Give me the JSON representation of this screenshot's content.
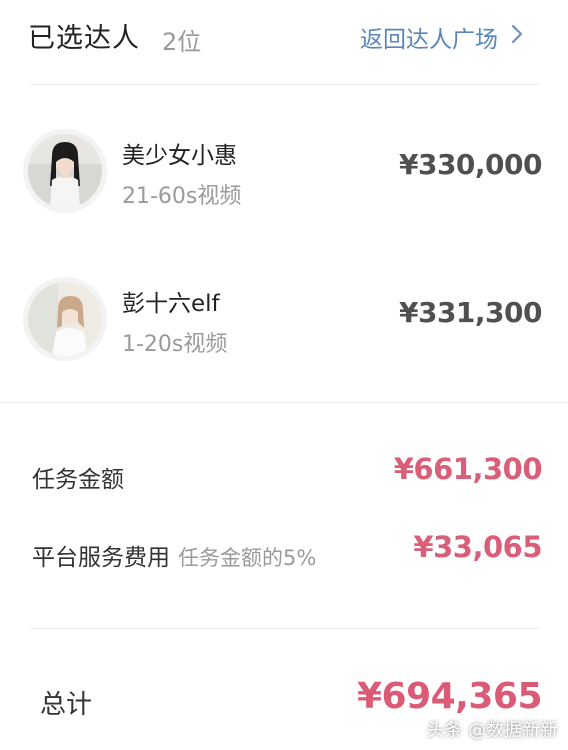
{
  "header": {
    "title": "已选达人",
    "count": "2位",
    "back_link": "返回达人广场",
    "back_icon": "chevron-right-icon"
  },
  "influencers": [
    {
      "name": "美少女小惠",
      "tag": "21-60s视频",
      "price": "¥330,000",
      "avatar": "avatar-photo"
    },
    {
      "name": "彭十六elf",
      "tag": "1-20s视频",
      "price": "¥331,300",
      "avatar": "avatar-photo"
    }
  ],
  "summary": {
    "task_amount_label": "任务金额",
    "task_amount": "¥661,300",
    "service_fee_label": "平台服务费用",
    "service_fee_note": "任务金额的5%",
    "service_fee": "¥33,065",
    "total_label": "总计",
    "total": "¥694,365"
  },
  "watermark": "头条 @数据新新",
  "colors": {
    "accent_link": "#5a86b8",
    "amount_pink": "#d95e78",
    "price_gray": "#505050"
  }
}
